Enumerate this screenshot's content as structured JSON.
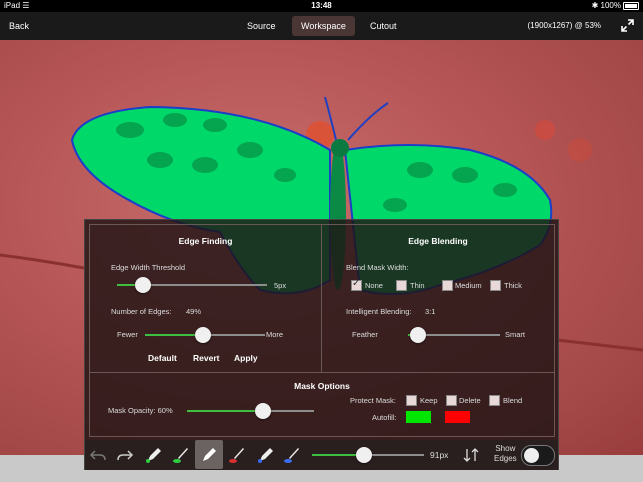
{
  "status": {
    "device": "iPad",
    "time": "13:48",
    "battery": "100%"
  },
  "nav": {
    "back": "Back",
    "tabs": [
      "Source",
      "Workspace",
      "Cutout"
    ],
    "active_tab": "Workspace",
    "resolution": "(1900x1267) @ 53%"
  },
  "edge_finding": {
    "title": "Edge Finding",
    "width_label": "Edge Width Threshold",
    "width_value": "5px",
    "edges_label": "Number of Edges:",
    "edges_value": "49%",
    "fewer": "Fewer",
    "more": "More",
    "buttons": {
      "default": "Default",
      "revert": "Revert",
      "apply": "Apply"
    }
  },
  "edge_blending": {
    "title": "Edge Blending",
    "mask_width_label": "Blend Mask Width:",
    "options": [
      "None",
      "Thin",
      "Medium",
      "Thick"
    ],
    "selected": "None",
    "intelligent_label": "Intelligent Blending:",
    "intelligent_value": "3:1",
    "feather": "Feather",
    "smart": "Smart"
  },
  "mask_options": {
    "title": "Mask Options",
    "opacity_label": "Mask Opacity: 60%",
    "protect_label": "Protect Mask:",
    "protect_options": [
      "Keep",
      "Delete",
      "Blend"
    ],
    "autofill_label": "Autofill:",
    "autofill_colors": [
      "#00e600",
      "#ff0000"
    ]
  },
  "toolbar": {
    "brush_size": "91px",
    "show_edges": [
      "Show",
      "Edges"
    ]
  },
  "colors": {
    "accent_green": "#3fbf3f",
    "mask_green": "#00e070",
    "mask_red": "#b75656"
  }
}
